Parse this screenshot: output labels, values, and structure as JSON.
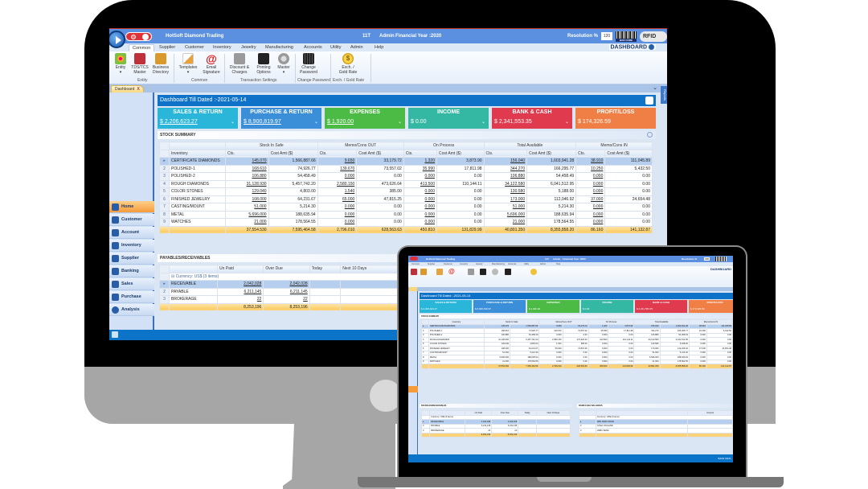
{
  "app": {
    "company": "HotSoft Diamond Trading",
    "user_code": "11T",
    "user": "Admin",
    "financial_year": "Financial Year :2020",
    "resolution_label": "Resolution %",
    "resolution_value": "120",
    "barcode_label": "BAR CODE",
    "rfid_label": "RFID",
    "dashboard_label": "DASHBOARD"
  },
  "ribbon": {
    "tabs": [
      "Common",
      "Supplier",
      "Customer",
      "Inventory",
      "Jewelry",
      "Manufacturing",
      "Accounts",
      "Utility",
      "Admin",
      "Help"
    ],
    "active_tab": "Common",
    "buttons": [
      {
        "label": "Entity",
        "sub": "▾",
        "icon": "people-icon"
      },
      {
        "label": "TDS/TCS",
        "sub": "Master",
        "icon": "tax-icon"
      },
      {
        "label": "Business",
        "sub": "Directory",
        "icon": "directory-book-icon"
      },
      {
        "label": "Templates",
        "sub": "▾",
        "icon": "templates-icon"
      },
      {
        "label": "Email",
        "sub": "Signature",
        "icon": "email-at-icon"
      },
      {
        "label": "Discount &",
        "sub": "Charges",
        "icon": "calculator-icon"
      },
      {
        "label": "Printing",
        "sub": "Options",
        "icon": "printer-gear-icon"
      },
      {
        "label": "Master",
        "sub": "▾",
        "icon": "gear-lock-icon"
      },
      {
        "label": "Change",
        "sub": "Password",
        "icon": "password-icon"
      },
      {
        "label": "Exch. /",
        "sub": "Gold Rate",
        "icon": "dollar-coin-icon"
      }
    ],
    "groups": [
      "Entity",
      "Common",
      "Transaction Settings",
      "Change Password",
      "Exch. / Gold Rate"
    ]
  },
  "doc_tab": {
    "label": "Dashboard",
    "close": "X"
  },
  "reports_tab": "Reports",
  "sidebar": {
    "items": [
      {
        "label": "Home",
        "icon": "home-icon",
        "active": true
      },
      {
        "label": "Customer",
        "icon": "customer-icon"
      },
      {
        "label": "Account",
        "icon": "account-icon"
      },
      {
        "label": "Inventory",
        "icon": "cart-icon"
      },
      {
        "label": "Supplier",
        "icon": "supplier-icon"
      },
      {
        "label": "Banking",
        "icon": "bank-icon"
      },
      {
        "label": "Sales",
        "icon": "sales-icon"
      },
      {
        "label": "Purchase",
        "icon": "purchase-icon"
      },
      {
        "label": "Analysis",
        "icon": "analysis-icon"
      }
    ]
  },
  "dashboard": {
    "title": "Dashboard Till Dated :-2021-05-14",
    "kpis": [
      {
        "title": "SALES & RETURN",
        "value": "$ 2,206,623.27",
        "color": "#29b6d8",
        "dropdown": true,
        "underline": true
      },
      {
        "title": "PURCHASE & RETURN",
        "value": "$ 8,900,819.97",
        "color": "#3b8fd9",
        "dropdown": true,
        "underline": true
      },
      {
        "title": "EXPENSES",
        "value": "$ 1,920.00",
        "color": "#4cbb45",
        "dropdown": true,
        "underline": true
      },
      {
        "title": "INCOME",
        "value": "$ 0.00",
        "color": "#35b8a3",
        "dropdown": true,
        "underline": false
      },
      {
        "title": "BANK & CASH",
        "value": "$ 2,341,553.35",
        "color": "#e03a4e",
        "dropdown": true,
        "underline": false
      },
      {
        "title": "PROFIT/LOSS",
        "value": "$ 174,326.59",
        "color": "#ef7f45",
        "dropdown": false,
        "underline": false
      }
    ],
    "stock_summary": {
      "title": "STOCK SUMMARY",
      "groups": [
        "Stock In Safe",
        "Memo/Cons OUT",
        "On Process",
        "Total Available",
        "Memo/Cons IN"
      ],
      "columns": [
        "Inventory",
        "Cts.",
        "Cost Amt ($)"
      ],
      "rows": [
        {
          "n": "▸",
          "name": "CERTIFICATE DIAMONDS",
          "v": [
            "145.070",
            "1,566,887.66",
            "9.650",
            "33,179.72",
            "1.320",
            "3,873.90",
            "156.040",
            "1,603,941.28",
            "38.910",
            "111,045.89"
          ]
        },
        {
          "n": "2",
          "name": "POLISHED-1",
          "v": [
            "168.610",
            "74,926.77",
            "139.670",
            "73,557.02",
            "35.990",
            "17,811.98",
            "344.270",
            "166,295.77",
            "10.250",
            "5,432.50"
          ]
        },
        {
          "n": "3",
          "name": "POLISHED-2",
          "v": [
            "106.880",
            "54,458.49",
            "0.000",
            "0.00",
            "0.000",
            "0.00",
            "106.880",
            "54,458.49",
            "0.000",
            "0.00"
          ]
        },
        {
          "n": "4",
          "name": "ROUGH DIAMONDS",
          "v": [
            "31,128.930",
            "5,457,742.20",
            "2,580.150",
            "473,626.64",
            "413.500",
            "110,144.11",
            "34,122.580",
            "6,041,512.95",
            "0.000",
            "0.00"
          ]
        },
        {
          "n": "5",
          "name": "COLOR STONES",
          "v": [
            "129.040",
            "4,803.00",
            "1.540",
            "385.00",
            "0.000",
            "0.00",
            "130.580",
            "5,188.00",
            "0.000",
            "0.00"
          ]
        },
        {
          "n": "6",
          "name": "FINISHED JEWELRY",
          "v": [
            "108.000",
            "64,231.67",
            "65.000",
            "47,815.25",
            "0.000",
            "0.00",
            "173.000",
            "112,046.92",
            "37.000",
            "24,654.48"
          ]
        },
        {
          "n": "7",
          "name": "CASTING/MOUNT",
          "v": [
            "51.000",
            "5,214.30",
            "0.000",
            "0.00",
            "0.000",
            "0.00",
            "51.000",
            "5,214.30",
            "0.000",
            "0.00"
          ]
        },
        {
          "n": "8",
          "name": "METAL",
          "v": [
            "5,696.000",
            "188,635.94",
            "0.000",
            "0.00",
            "0.000",
            "0.00",
            "5,696.000",
            "188,635.94",
            "0.000",
            "0.00"
          ]
        },
        {
          "n": "9",
          "name": "WATCHES",
          "v": [
            "21.000",
            "178,564.55",
            "0.000",
            "0.00",
            "0.000",
            "0.00",
            "21.000",
            "178,564.55",
            "0.000",
            "0.00"
          ]
        }
      ],
      "totals": [
        "37,554.530",
        "7,595,464.58",
        "2,796.010",
        "628,563.63",
        "450.810",
        "131,829.99",
        "40,801.350",
        "8,355,858.20",
        "86.160",
        "141,132.87"
      ]
    },
    "payables": {
      "title": "PAYABLES/RECEIVABLES",
      "columns": [
        "Un Paid",
        "Over Due",
        "Today",
        "Next 10 Days"
      ],
      "group_label": "Currency: US$ (3 items)",
      "rows": [
        {
          "n": "▸",
          "name": "RECEIVABLE",
          "unpaid": "2,042,028",
          "overdue": "2,042,028"
        },
        {
          "n": "2",
          "name": "PAYABLE",
          "unpaid": "6,211,145",
          "overdue": "6,211,145"
        },
        {
          "n": "3",
          "name": "BROKERAGE",
          "unpaid": "22",
          "overdue": "22"
        }
      ],
      "totals": {
        "unpaid": "8,253,196",
        "overdue": "8,253,196"
      }
    },
    "bank_cash": {
      "title": "BANK/CASH BALANCES",
      "column": "Amount",
      "group_label": "Currency: US$ (3 items)",
      "rows": [
        "ABN AMRO BANK",
        "CASH ON HAND",
        "HSBC BANK"
      ]
    }
  },
  "laptop_status": "BANK DETL"
}
